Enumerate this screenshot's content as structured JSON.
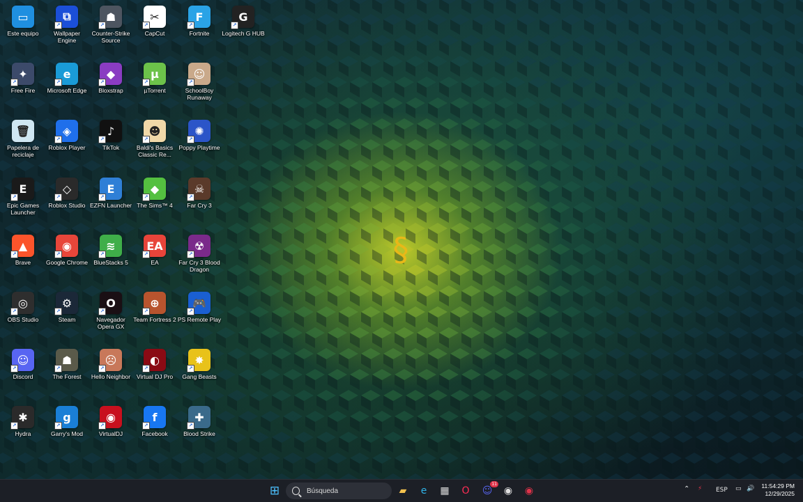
{
  "wallpaper": {
    "name": "razer-hex-wallpaper",
    "accent": "#d6dc28"
  },
  "desktop_icons": [
    {
      "label": "Este equipo",
      "icon": "monitor-icon",
      "bg": "#1f8fe0",
      "glyph": "▭"
    },
    {
      "label": "Wallpaper Engine",
      "icon": "wallpaper-engine-icon",
      "bg": "#1b4fd8",
      "glyph": "⧉"
    },
    {
      "label": "Counter-Strike Source",
      "icon": "counter-strike-icon",
      "bg": "#4d5560",
      "glyph": "☗"
    },
    {
      "label": "CapCut",
      "icon": "capcut-icon",
      "bg": "#ffffff",
      "glyph": "✂"
    },
    {
      "label": "Fortnite",
      "icon": "fortnite-icon",
      "bg": "#2aa3e6",
      "glyph": "F"
    },
    {
      "label": "Logitech G HUB",
      "icon": "logitech-icon",
      "bg": "#222222",
      "glyph": "G"
    },
    {
      "label": "Free Fire",
      "icon": "free-fire-icon",
      "bg": "#3c4a6a",
      "glyph": "✦"
    },
    {
      "label": "Microsoft Edge",
      "icon": "edge-icon",
      "bg": "#1a9bd7",
      "glyph": "e"
    },
    {
      "label": "Bloxstrap",
      "icon": "bloxstrap-icon",
      "bg": "#8a3cc2",
      "glyph": "◆"
    },
    {
      "label": "µTorrent",
      "icon": "utorrent-icon",
      "bg": "#6cc24a",
      "glyph": "µ"
    },
    {
      "label": "SchoolBoy Runaway",
      "icon": "schoolboy-icon",
      "bg": "#c9a98a",
      "glyph": "☺"
    },
    {
      "label": "Papelera de reciclaje",
      "icon": "recycle-bin-icon",
      "bg": "#cfe6f2",
      "glyph": "🗑"
    },
    {
      "label": "Roblox Player",
      "icon": "roblox-player-icon",
      "bg": "#1f6feb",
      "glyph": "◈"
    },
    {
      "label": "TikTok",
      "icon": "tiktok-icon",
      "bg": "#111111",
      "glyph": "♪"
    },
    {
      "label": "Baldi's Basics Classic Re...",
      "icon": "baldi-icon",
      "bg": "#f0d8a8",
      "glyph": "☻"
    },
    {
      "label": "Poppy Playtime",
      "icon": "poppy-playtime-icon",
      "bg": "#2b55c8",
      "glyph": "✺"
    },
    {
      "label": "Epic Games Launcher",
      "icon": "epic-games-icon",
      "bg": "#1a1a1a",
      "glyph": "E"
    },
    {
      "label": "Roblox Studio",
      "icon": "roblox-studio-icon",
      "bg": "#2a2a2a",
      "glyph": "◇"
    },
    {
      "label": "EZFN Launcher",
      "icon": "ezfn-icon",
      "bg": "#2f7fd6",
      "glyph": "E"
    },
    {
      "label": "The Sims™ 4",
      "icon": "sims-icon",
      "bg": "#54c040",
      "glyph": "◆"
    },
    {
      "label": "Far Cry 3",
      "icon": "far-cry-3-icon",
      "bg": "#5a3a2a",
      "glyph": "☠"
    },
    {
      "label": "Brave",
      "icon": "brave-icon",
      "bg": "#fb542b",
      "glyph": "▲"
    },
    {
      "label": "Google Chrome",
      "icon": "chrome-icon",
      "bg": "#e8463a",
      "glyph": "◉"
    },
    {
      "label": "BlueStacks 5",
      "icon": "bluestacks-icon",
      "bg": "#3fae49",
      "glyph": "≋"
    },
    {
      "label": "EA",
      "icon": "ea-icon",
      "bg": "#e8443a",
      "glyph": "EA"
    },
    {
      "label": "Far Cry 3 Blood Dragon",
      "icon": "blood-dragon-icon",
      "bg": "#7a2a8a",
      "glyph": "☢"
    },
    {
      "label": "OBS Studio",
      "icon": "obs-icon",
      "bg": "#2e2e2e",
      "glyph": "◎"
    },
    {
      "label": "Steam",
      "icon": "steam-icon",
      "bg": "#1b2838",
      "glyph": "⚙"
    },
    {
      "label": "Navegador Opera GX",
      "icon": "opera-gx-icon",
      "bg": "#1a0f14",
      "glyph": "O"
    },
    {
      "label": "Team Fortress 2",
      "icon": "tf2-icon",
      "bg": "#b8542e",
      "glyph": "⊕"
    },
    {
      "label": "PS Remote Play",
      "icon": "ps-remote-play-icon",
      "bg": "#1a5fd1",
      "glyph": "🎮"
    },
    {
      "label": "Discord",
      "icon": "discord-icon",
      "bg": "#5865f2",
      "glyph": "☺"
    },
    {
      "label": "The Forest",
      "icon": "the-forest-icon",
      "bg": "#5a5a4a",
      "glyph": "☗"
    },
    {
      "label": "Hello Neighbor",
      "icon": "hello-neighbor-icon",
      "bg": "#c8785a",
      "glyph": "☹"
    },
    {
      "label": "Virtual DJ Pro",
      "icon": "virtual-dj-pro-icon",
      "bg": "#8a0a14",
      "glyph": "◐"
    },
    {
      "label": "Gang Beasts",
      "icon": "gang-beasts-icon",
      "bg": "#e8c21a",
      "glyph": "✸"
    },
    {
      "label": "Hydra",
      "icon": "hydra-icon",
      "bg": "#2a2a2a",
      "glyph": "✱"
    },
    {
      "label": "Garry's Mod",
      "icon": "garrys-mod-icon",
      "bg": "#1a7fd6",
      "glyph": "g"
    },
    {
      "label": "VirtualDJ",
      "icon": "virtualdj-icon",
      "bg": "#c8101e",
      "glyph": "◉"
    },
    {
      "label": "Facebook",
      "icon": "facebook-icon",
      "bg": "#1877f2",
      "glyph": "f"
    },
    {
      "label": "Blood Strike",
      "icon": "blood-strike-icon",
      "bg": "#3a6a8a",
      "glyph": "✚"
    }
  ],
  "taskbar": {
    "search_placeholder": "Búsqueda",
    "apps": [
      {
        "name": "start-button",
        "glyph": "⊞",
        "color": "#4cc2ff"
      },
      {
        "name": "file-explorer-taskbar-icon",
        "glyph": "▰",
        "color": "#f2c14e"
      },
      {
        "name": "edge-taskbar-icon",
        "glyph": "e",
        "color": "#2fb3e8"
      },
      {
        "name": "store-taskbar-icon",
        "glyph": "▦",
        "color": "#dddddd"
      },
      {
        "name": "opera-gx-taskbar-icon",
        "glyph": "O",
        "color": "#ff2d55"
      },
      {
        "name": "discord-taskbar-icon",
        "glyph": "☺",
        "color": "#5865f2"
      },
      {
        "name": "chrome-taskbar-icon",
        "glyph": "◉",
        "color": "#e0e0e0"
      },
      {
        "name": "virtualdj-taskbar-icon",
        "glyph": "◉",
        "color": "#e0334a"
      }
    ],
    "discord_badge": "11",
    "language": "ESP",
    "time": "11:54:29 PM",
    "date": "12/29/2025"
  }
}
